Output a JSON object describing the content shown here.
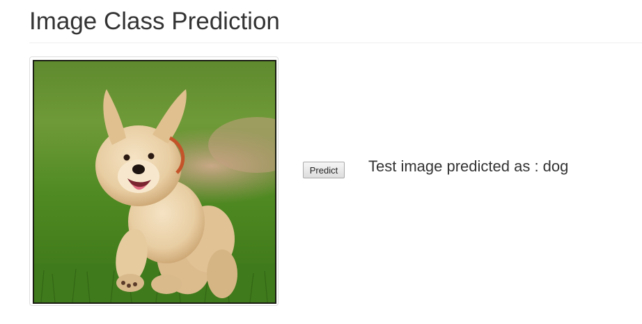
{
  "header": {
    "title": "Image Class Prediction"
  },
  "preview": {
    "icon": "dog-photo",
    "subject": "golden retriever puppy running on grass"
  },
  "actions": {
    "predict_label": "Predict"
  },
  "result": {
    "text": "Test image predicted as : dog"
  }
}
